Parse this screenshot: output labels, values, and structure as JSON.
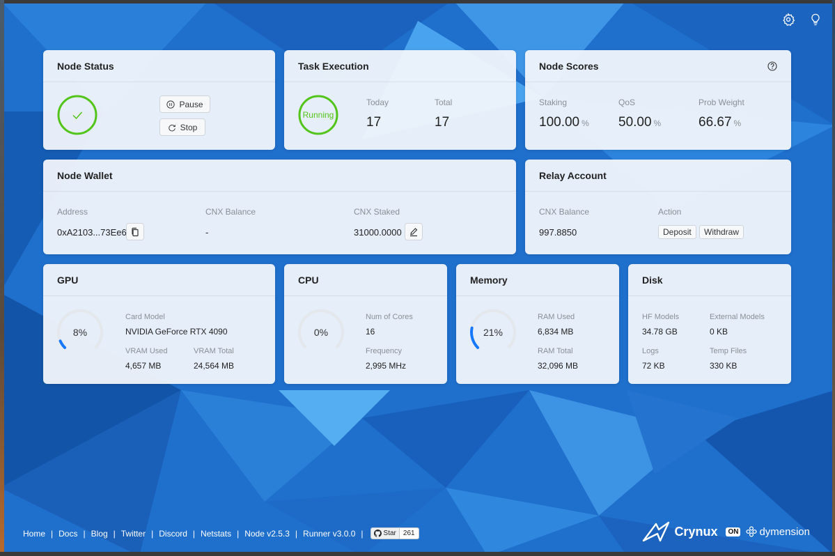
{
  "colors": {
    "accent_green": "#52c41a",
    "accent_blue": "#1677ff",
    "track": "#e4e7eb"
  },
  "node_status": {
    "title": "Node Status",
    "state_icon": "check-icon",
    "pause_label": "Pause",
    "stop_label": "Stop"
  },
  "task_execution": {
    "title": "Task Execution",
    "state": "Running",
    "today_label": "Today",
    "today_value": "17",
    "total_label": "Total",
    "total_value": "17"
  },
  "node_scores": {
    "title": "Node Scores",
    "help_icon": "question-circle-icon",
    "staking_label": "Staking",
    "staking_value": "100.00",
    "qos_label": "QoS",
    "qos_value": "50.00",
    "prob_label": "Prob Weight",
    "prob_value": "66.67",
    "unit": "%"
  },
  "node_wallet": {
    "title": "Node Wallet",
    "address_label": "Address",
    "address_value": "0xA2103...73Ee6",
    "cnx_balance_label": "CNX Balance",
    "cnx_balance_value": "-",
    "cnx_staked_label": "CNX Staked",
    "cnx_staked_value": "31000.0000"
  },
  "relay_account": {
    "title": "Relay Account",
    "cnx_balance_label": "CNX Balance",
    "cnx_balance_value": "997.8850",
    "action_label": "Action",
    "deposit_label": "Deposit",
    "withdraw_label": "Withdraw"
  },
  "gpu": {
    "title": "GPU",
    "usage_percent": 8,
    "usage_text": "8%",
    "card_model_label": "Card Model",
    "card_model_value": "NVIDIA GeForce RTX 4090",
    "vram_used_label": "VRAM Used",
    "vram_used_value": "4,657 MB",
    "vram_total_label": "VRAM Total",
    "vram_total_value": "24,564 MB"
  },
  "cpu": {
    "title": "CPU",
    "usage_percent": 0,
    "usage_text": "0%",
    "cores_label": "Num of Cores",
    "cores_value": "16",
    "freq_label": "Frequency",
    "freq_value": "2,995 MHz"
  },
  "memory": {
    "title": "Memory",
    "usage_percent": 21,
    "usage_text": "21%",
    "ram_used_label": "RAM Used",
    "ram_used_value": "6,834 MB",
    "ram_total_label": "RAM Total",
    "ram_total_value": "32,096 MB"
  },
  "disk": {
    "title": "Disk",
    "hf_label": "HF Models",
    "hf_value": "34.78 GB",
    "ext_label": "External Models",
    "ext_value": "0 KB",
    "logs_label": "Logs",
    "logs_value": "72 KB",
    "temp_label": "Temp Files",
    "temp_value": "330 KB"
  },
  "footer": {
    "links": [
      "Home",
      "Docs",
      "Blog",
      "Twitter",
      "Discord",
      "Netstats",
      "Node v2.5.3",
      "Runner v3.0.0"
    ],
    "github_star_label": "Star",
    "github_star_count": "261"
  },
  "brand": {
    "crynux": "Crynux",
    "on": "ON",
    "dymension": "dymension"
  },
  "top_icons": [
    "gear-icon",
    "lightbulb-icon"
  ]
}
